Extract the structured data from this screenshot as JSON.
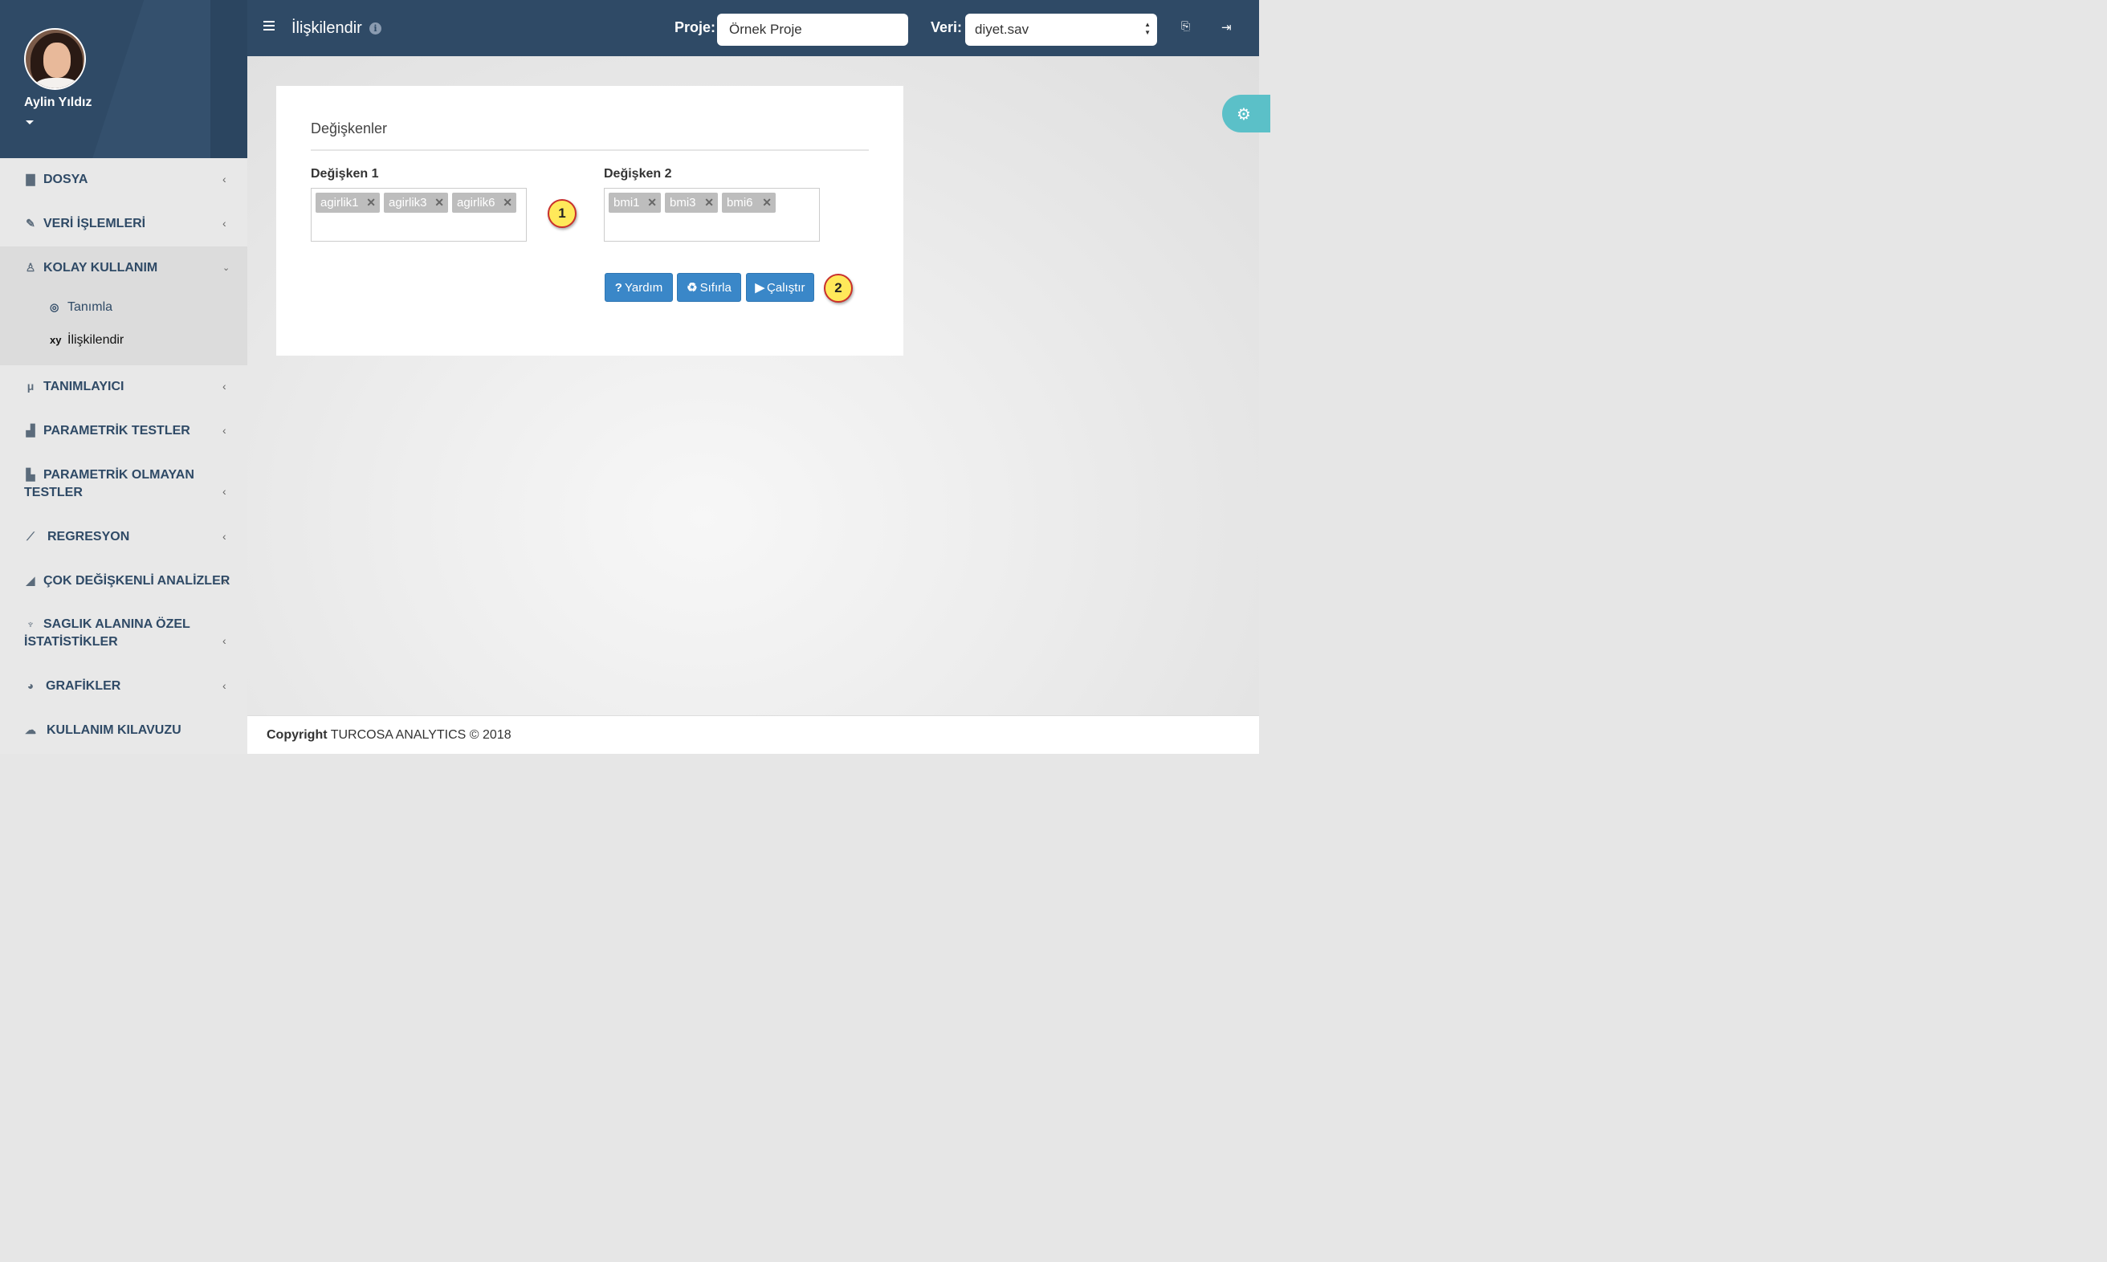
{
  "user": {
    "name": "Aylin Yıldız"
  },
  "menu": {
    "dosya": "DOSYA",
    "veri_islemleri": "VERİ İŞLEMLERİ",
    "kolay_kullanim": "KOLAY KULLANIM",
    "sub_tanimla": "Tanımla",
    "sub_iliskilendir": "İlişkilendir",
    "tanimlayici": "TANIMLAYICI",
    "parametrik": "PARAMETRİK TESTLER",
    "parametrik_olmayan_1": "PARAMETRİK OLMAYAN",
    "parametrik_olmayan_2": "TESTLER",
    "regresyon": "REGRESYON",
    "cok_degiskenli": "ÇOK DEĞİŞKENLİ ANALİZLER",
    "saglik_1": "SAGLIK ALANINA ÖZEL",
    "saglik_2": "İSTATİSTİKLER",
    "grafikler": "GRAFİKLER",
    "kilavuz": "KULLANIM KILAVUZU"
  },
  "header": {
    "title": "İlişkilendir",
    "proje_label": "Proje:",
    "proje_value": "Örnek Proje",
    "veri_label": "Veri:",
    "veri_value": "diyet.sav"
  },
  "card": {
    "title": "Değişkenler",
    "var1_label": "Değişken 1",
    "var1_tags": [
      "agirlik1",
      "agirlik3",
      "agirlik6"
    ],
    "var2_label": "Değişken 2",
    "var2_tags": [
      "bmi1",
      "bmi3",
      "bmi6"
    ],
    "marker1": "1",
    "marker2": "2",
    "btn_help": "Yardım",
    "btn_reset": "Sıfırla",
    "btn_run": "Çalıştır"
  },
  "footer": {
    "copyright_bold": "Copyright",
    "copyright_text": "TURCOSA ANALYTICS © 2018"
  },
  "colors": {
    "navy": "#2f4a66",
    "button_blue": "#3a87c8",
    "teal": "#5bc0c8",
    "marker_yellow": "#ffe95a"
  },
  "icons": [
    "file-icon",
    "wrench-icon",
    "thumbs-up-icon",
    "mu-icon",
    "bar-chart-icon",
    "area-chart-icon",
    "line-chart-icon",
    "stethoscope-icon",
    "pie-chart-icon",
    "cloud-download-icon",
    "gear-icon",
    "info-icon",
    "translate-icon",
    "logout-icon"
  ]
}
